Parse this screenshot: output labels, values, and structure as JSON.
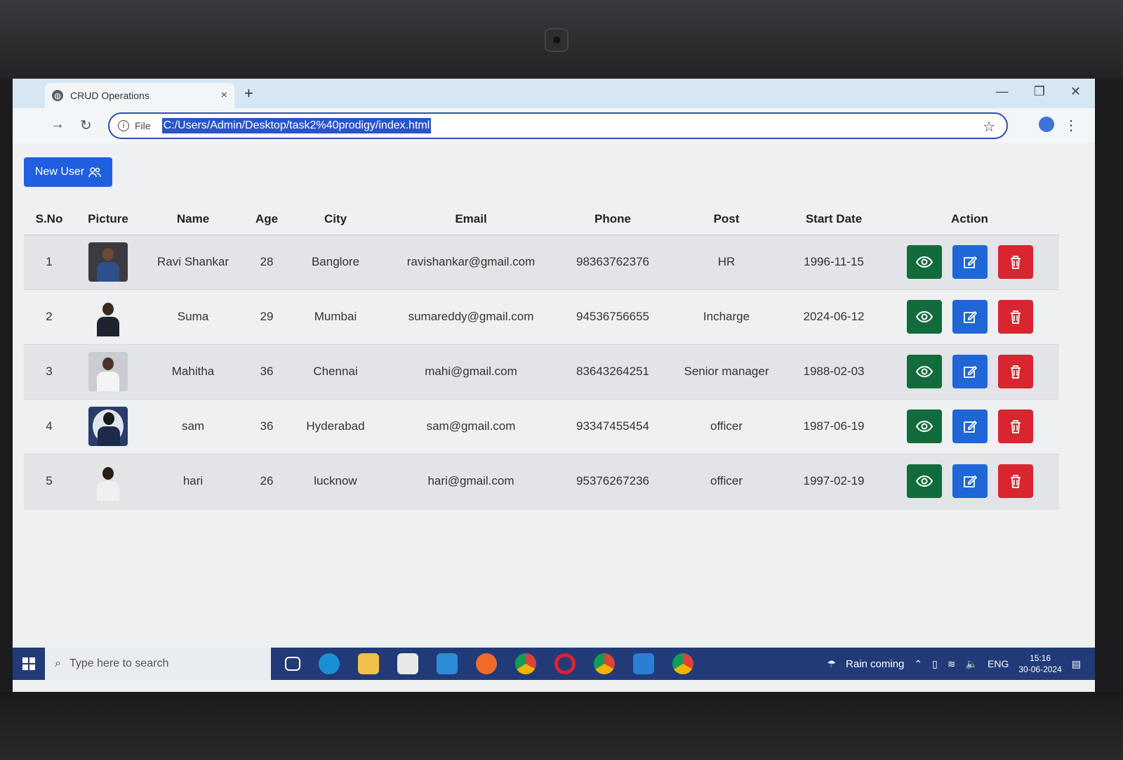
{
  "browser": {
    "tab_title": "CRUD Operations",
    "tab_close": "×",
    "new_tab": "+",
    "file_label": "File",
    "url": "C:/Users/Admin/Desktop/task2%40prodigy/index.html"
  },
  "page": {
    "new_user_label": "New User",
    "columns": [
      "S.No",
      "Picture",
      "Name",
      "Age",
      "City",
      "Email",
      "Phone",
      "Post",
      "Start Date",
      "Action"
    ],
    "rows": [
      {
        "sno": "1",
        "name": "Ravi Shankar",
        "age": "28",
        "city": "Banglore",
        "email": "ravishankar@gmail.com",
        "phone": "98363762376",
        "post": "HR",
        "start": "1996-11-15"
      },
      {
        "sno": "2",
        "name": "Suma",
        "age": "29",
        "city": "Mumbai",
        "email": "sumareddy@gmail.com",
        "phone": "94536756655",
        "post": "Incharge",
        "start": "2024-06-12"
      },
      {
        "sno": "3",
        "name": "Mahitha",
        "age": "36",
        "city": "Chennai",
        "email": "mahi@gmail.com",
        "phone": "83643264251",
        "post": "Senior manager",
        "start": "1988-02-03"
      },
      {
        "sno": "4",
        "name": "sam",
        "age": "36",
        "city": "Hyderabad",
        "email": "sam@gmail.com",
        "phone": "93347455454",
        "post": "officer",
        "start": "1987-06-19"
      },
      {
        "sno": "5",
        "name": "hari",
        "age": "26",
        "city": "lucknow",
        "email": "hari@gmail.com",
        "phone": "95376267236",
        "post": "officer",
        "start": "1997-02-19"
      }
    ]
  },
  "taskbar": {
    "search_placeholder": "Type here to search",
    "weather": "Rain coming",
    "lang": "ENG",
    "time": "15:16",
    "date": "30-06-2024"
  },
  "colors": {
    "view": "#126b3b",
    "edit": "#1f66d6",
    "delete": "#d7262f",
    "primary": "#1f5fe0"
  }
}
